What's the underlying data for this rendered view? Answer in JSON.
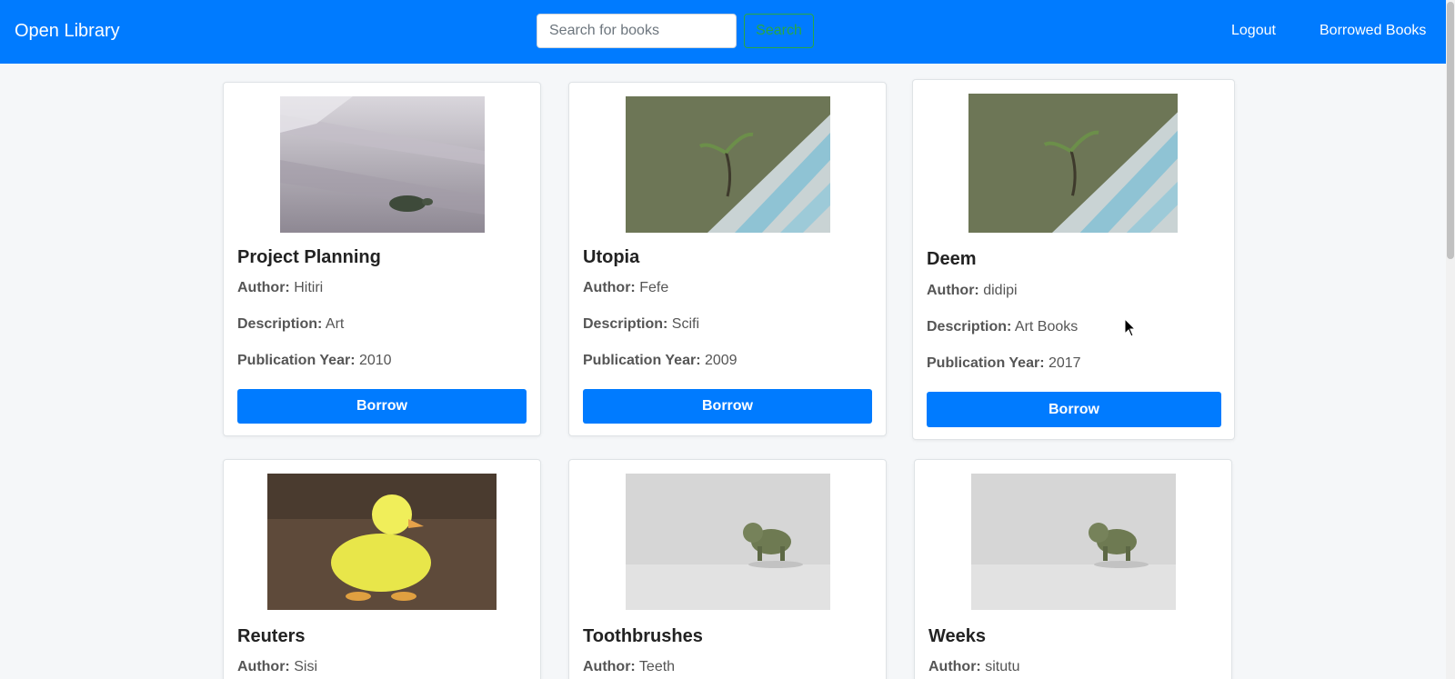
{
  "navbar": {
    "brand": "Open Library",
    "search_placeholder": "Search for books",
    "search_label": "Search",
    "logout_label": "Logout",
    "borrowed_label": "Borrowed Books"
  },
  "labels": {
    "author": "Author:",
    "description": "Description:",
    "year": "Publication Year:",
    "borrow": "Borrow"
  },
  "books": [
    {
      "title": "Project Planning",
      "author": "Hitiri",
      "description": "Art",
      "year": "2010",
      "image": "turtle-photo"
    },
    {
      "title": "Utopia",
      "author": "Fefe",
      "description": "Scifi",
      "year": "2009",
      "image": "sprout-photo"
    },
    {
      "title": "Deem",
      "author": "didipi",
      "description": "Art Books",
      "year": "2017",
      "image": "sprout-photo"
    },
    {
      "title": "Reuters",
      "author": "Sisi",
      "image": "duckling-photo"
    },
    {
      "title": "Toothbrushes",
      "author": "Teeth",
      "image": "elephant-toy-photo"
    },
    {
      "title": "Weeks",
      "author": "situtu",
      "image": "elephant-toy-photo"
    }
  ],
  "colors": {
    "primary": "#007bff",
    "success": "#28a745",
    "background": "#f5f7f9"
  }
}
